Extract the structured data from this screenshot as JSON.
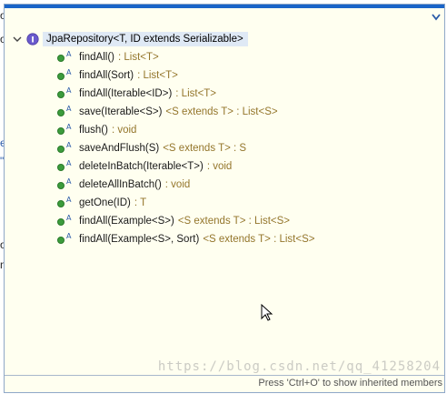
{
  "popup": {
    "root": {
      "label": "JpaRepository<T, ID extends Serializable>"
    },
    "methods": [
      {
        "name": "findAll()",
        "type": ": List<T>"
      },
      {
        "name": "findAll(Sort)",
        "type": ": List<T>"
      },
      {
        "name": "findAll(Iterable<ID>)",
        "type": ": List<T>"
      },
      {
        "name": "save(Iterable<S>)",
        "type": "<S extends T> : List<S>"
      },
      {
        "name": "flush()",
        "type": ": void"
      },
      {
        "name": "saveAndFlush(S)",
        "type": "<S extends T> : S"
      },
      {
        "name": "deleteInBatch(Iterable<T>)",
        "type": ": void"
      },
      {
        "name": "deleteAllInBatch()",
        "type": ": void"
      },
      {
        "name": "getOne(ID)",
        "type": ": T"
      },
      {
        "name": "findAll(Example<S>)",
        "type": "<S extends T> : List<S>"
      },
      {
        "name": "findAll(Example<S>, Sort)",
        "type": "<S extends T> : List<S>"
      }
    ],
    "footer": "Press 'Ctrl+O' to show inherited members",
    "watermark": "https://blog.csdn.net/qq_41258204"
  },
  "background": {
    "fragments": [
      "o",
      "o",
      "e",
      "\"",
      "o",
      "n"
    ]
  },
  "colors": {
    "accent": "#1a64c8",
    "method_dot": "#3c9c3c",
    "type_text": "#94762c",
    "selection": "#dfe9f5"
  },
  "icons": {
    "tree_toggle": "chevron-down-icon",
    "interface": "interface-icon",
    "method": "public-method-icon",
    "menu": "dropdown-icon"
  }
}
